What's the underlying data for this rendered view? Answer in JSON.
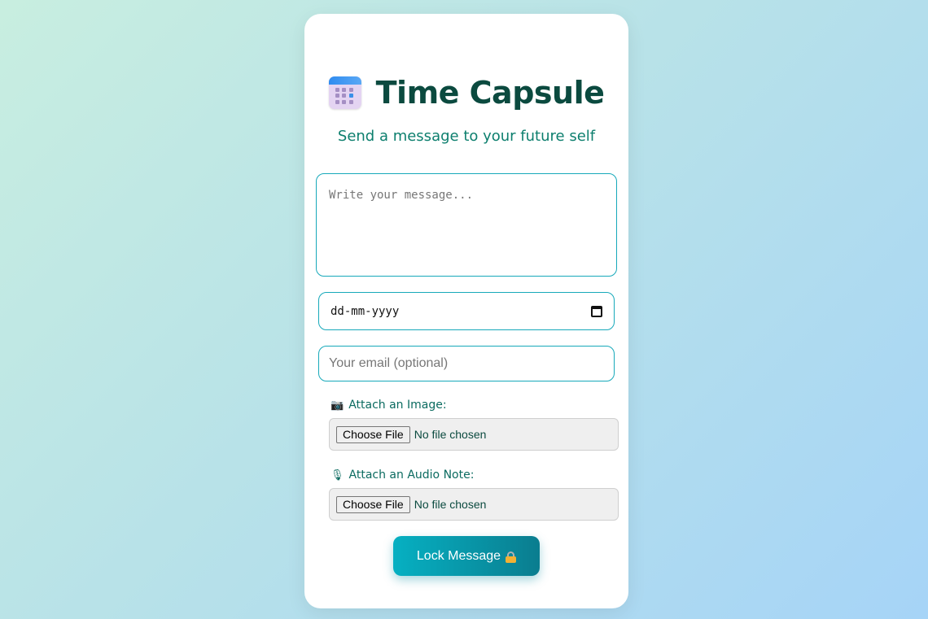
{
  "app": {
    "title": "Time Capsule",
    "subtitle": "Send a message to your future self",
    "title_icon": "calendar-icon"
  },
  "form": {
    "message": {
      "placeholder": "Write your message...",
      "value": ""
    },
    "date": {
      "display": "dd-mm-yyyy",
      "icon": "calendar-picker-icon"
    },
    "email": {
      "placeholder": "Your email (optional)",
      "value": ""
    },
    "image_attach": {
      "label": "Attach an Image:",
      "icon": "camera-icon",
      "button_label": "Choose File",
      "status": "No file chosen"
    },
    "audio_attach": {
      "label": "Attach an Audio Note:",
      "icon": "microphone-icon",
      "button_label": "Choose File",
      "status": "No file chosen"
    },
    "submit": {
      "label": "Lock Message",
      "icon": "lock-icon"
    }
  },
  "colors": {
    "accent": "#17a9ba",
    "title": "#0b4a3f",
    "subtitle": "#0d7f6e",
    "button_start": "#06b0c2",
    "button_end": "#0a7d8f"
  }
}
